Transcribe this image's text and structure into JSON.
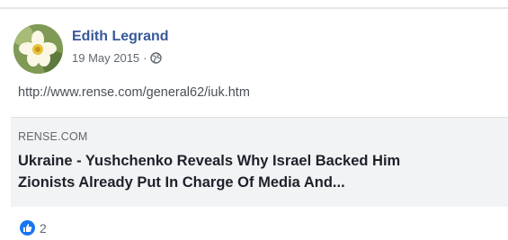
{
  "post": {
    "author": "Edith Legrand",
    "date": "19 May 2015",
    "separator": "·",
    "audience_icon": "globe-icon",
    "link_text": "http://www.rense.com/general62/iuk.htm"
  },
  "preview": {
    "domain": "RENSE.COM",
    "title_line1": "Ukraine - Yushchenko Reveals Why Israel Backed Him",
    "title_line2": "Zionists Already Put In Charge Of Media And..."
  },
  "reactions": {
    "icon": "like-icon",
    "count": "2"
  },
  "colors": {
    "author": "#385898",
    "like": "#1877f2",
    "preview_bg": "#f2f3f5"
  }
}
